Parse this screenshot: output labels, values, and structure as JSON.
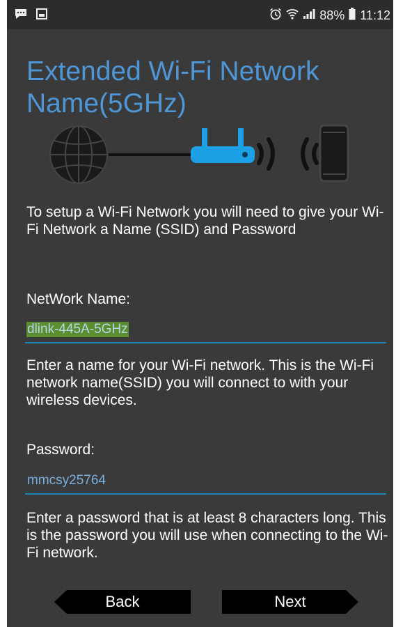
{
  "status_bar": {
    "left_icons": [
      "chat-icon",
      "image-icon"
    ],
    "battery": "88%",
    "time": "11:12",
    "right_icons": [
      "alarm-icon",
      "wifi-icon",
      "signal-icon",
      "battery-icon"
    ]
  },
  "page": {
    "title": "Extended Wi-Fi Network Name(5GHz)",
    "illustration_icons": [
      "globe-icon",
      "router-icon",
      "wireless-waves-icon",
      "phone-icon"
    ],
    "intro": "To setup a Wi-Fi Network you will need to give your Wi-Fi Network a Name (SSID) and Password"
  },
  "form": {
    "network_name": {
      "label": "NetWork Name:",
      "value": "dlink-445A-5GHz",
      "help": "Enter a name for your Wi-Fi network. This is the Wi-Fi network name(SSID) you will connect to with your wireless devices."
    },
    "password": {
      "label": "Password:",
      "value": "mmcsy25764",
      "help": "Enter a password that is at least 8 characters long. This is the password you will use when connecting to the Wi-Fi network."
    }
  },
  "buttons": {
    "back": "Back",
    "next": "Next"
  },
  "colors": {
    "background": "#3a3a3a",
    "title": "#4f96d6",
    "accent": "#1f82b5",
    "router": "#1ea0e6",
    "selection": "#5a8e2e"
  }
}
